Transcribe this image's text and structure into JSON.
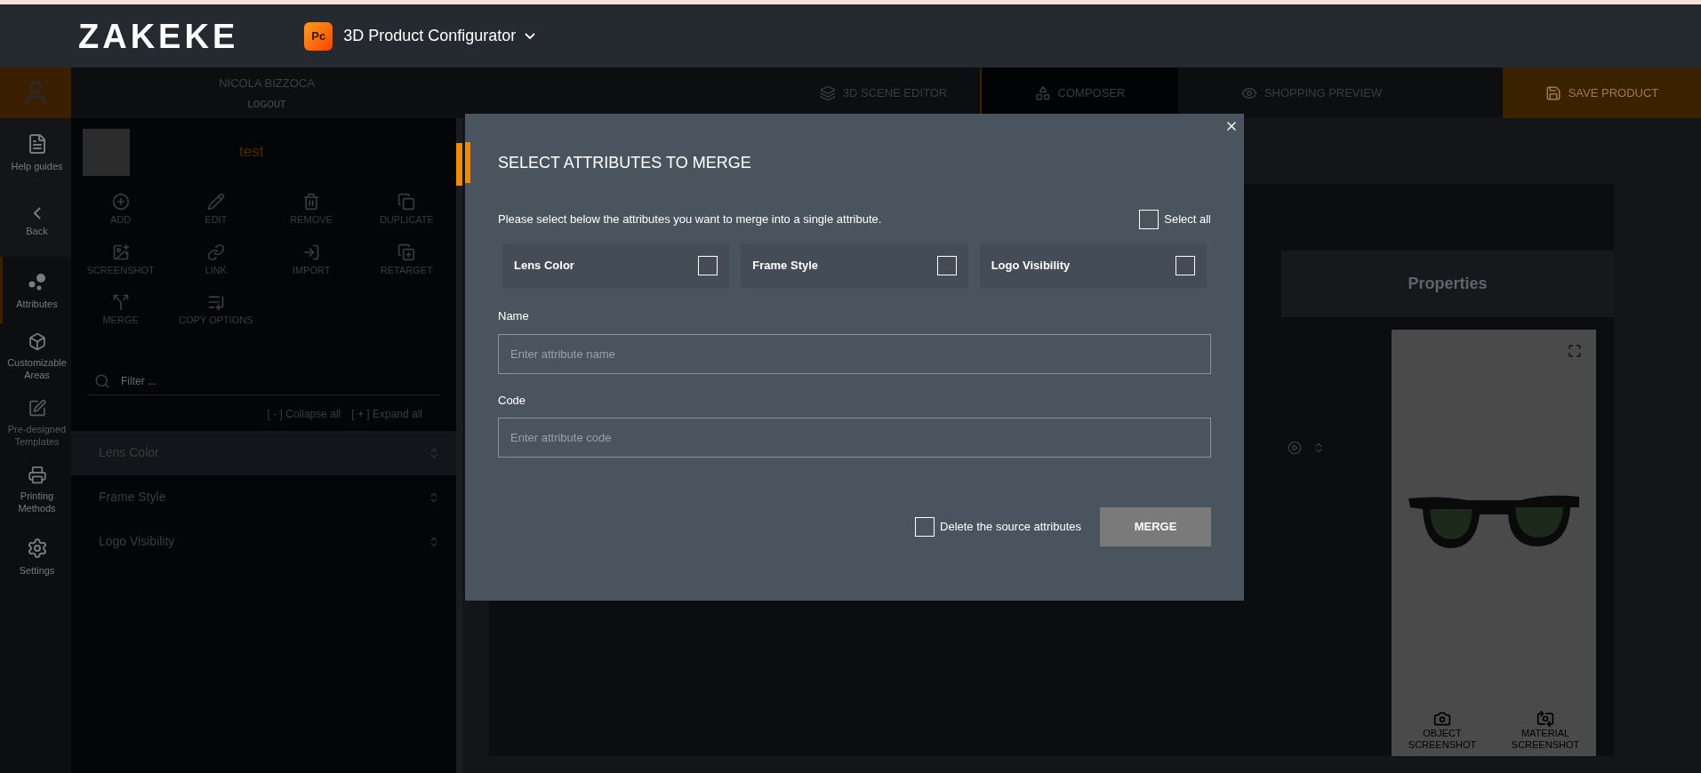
{
  "header": {
    "logo": "ZAKEKE",
    "app_badge": "Pc",
    "app_name": "3D Product Configurator"
  },
  "user": {
    "name": "NICOLA BIZZOCA",
    "logout": "LOGOUT"
  },
  "mode_tabs": [
    {
      "label": "3D SCENE EDITOR",
      "selected": false
    },
    {
      "label": "COMPOSER",
      "selected": true
    },
    {
      "label": "SHOPPING PREVIEW",
      "selected": false
    }
  ],
  "save_button": "SAVE PRODUCT",
  "sidebar": {
    "items": [
      {
        "label": "Help guides",
        "selected": false,
        "disabled": false
      },
      {
        "label": "Back",
        "selected": false,
        "disabled": false
      },
      {
        "label": "Attributes",
        "selected": true,
        "disabled": false
      },
      {
        "label": "Customizable Areas",
        "selected": false,
        "disabled": false
      },
      {
        "label": "Pre-designed Templates",
        "selected": false,
        "disabled": true
      },
      {
        "label": "Printing Methods",
        "selected": false,
        "disabled": false
      },
      {
        "label": "Settings",
        "selected": false,
        "disabled": false
      }
    ]
  },
  "product": {
    "title": "test"
  },
  "actions": [
    "ADD",
    "EDIT",
    "REMOVE",
    "DUPLICATE",
    "SCREENSHOT",
    "LINK",
    "IMPORT",
    "RETARGET",
    "MERGE",
    "COPY OPTIONS"
  ],
  "filter": {
    "placeholder": "Filter ..."
  },
  "collapse_all": "[ - ] Collapse all",
  "expand_all": "[ + ] Expand all",
  "attributes": [
    {
      "label": "Lens Color",
      "selected": true
    },
    {
      "label": "Frame Style",
      "selected": false
    },
    {
      "label": "Logo Visibility",
      "selected": false
    }
  ],
  "properties_tab": "Properties",
  "preview": {
    "buttons": [
      "OBJECT SCREENSHOT",
      "MATERIAL SCREENSHOT"
    ]
  },
  "dialog": {
    "title": "SELECT ATTRIBUTES TO MERGE",
    "instructions": "Please select below the attributes you want to merge into a single attribute.",
    "select_all": {
      "label": "Select all",
      "checked": false
    },
    "attributes": [
      {
        "label": "Lens Color",
        "checked": false
      },
      {
        "label": "Frame Style",
        "checked": false
      },
      {
        "label": "Logo Visibility",
        "checked": false
      }
    ],
    "name_field": {
      "label": "Name",
      "placeholder": "Enter attribute name"
    },
    "code_field": {
      "label": "Code",
      "placeholder": "Enter attribute code"
    },
    "delete_source": {
      "label": "Delete the source attributes",
      "checked": false
    },
    "merge_button": "MERGE"
  }
}
